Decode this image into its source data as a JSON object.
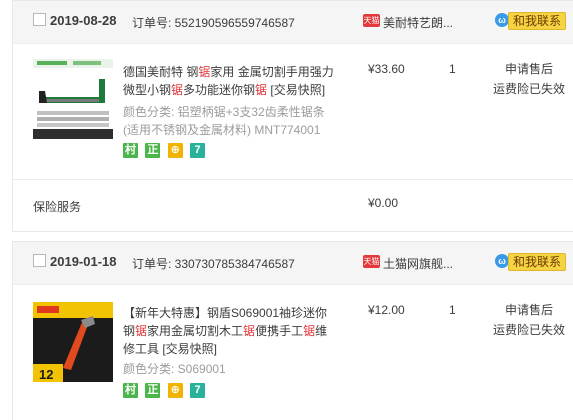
{
  "orders": [
    {
      "date": "2019-08-28",
      "order_label": "订单号: 552190596559746587",
      "shop_icon_text": "天猫",
      "shop_name": "美耐特艺朗...",
      "contact_label": "和我联系",
      "contact_icon": "wangwang-icon",
      "item": {
        "title_parts": [
          "德国美耐特 钢",
          "锯",
          "家用 金属切割手用强力微型小钢",
          "锯",
          "多功能迷你钢",
          "锯",
          " [交易快照]"
        ],
        "sku": "颜色分类: 铝塑柄锯+3支32齿柔性锯条(适用不锈钢及金属材料) MNT774001",
        "tags": [
          "村",
          "正",
          "⊕",
          "7"
        ],
        "price": "¥33.60",
        "qty": "1",
        "status": [
          "申请售后",
          "运费险已失效"
        ]
      },
      "service": {
        "label": "保险服务",
        "price": "¥0.00"
      }
    },
    {
      "date": "2019-01-18",
      "order_label": "订单号: 330730785384746587",
      "shop_icon_text": "天猫",
      "shop_name": "土猫网旗舰...",
      "contact_label": "和我联系",
      "contact_icon": "wangwang-icon",
      "item": {
        "title_parts": [
          "【新年大特惠】钢盾S069001袖珍迷你钢",
          "锯",
          "家用金属切割木工",
          "锯",
          "便携手工",
          "锯",
          "维修工具 [交易快照]"
        ],
        "sku": "颜色分类: S069001",
        "tags": [
          "村",
          "正",
          "⊕",
          "7"
        ],
        "price": "¥12.00",
        "qty": "1",
        "status": [
          "申请售后",
          "运费险已失效"
        ],
        "thumb_text": "12"
      }
    }
  ],
  "colors": {
    "highlight": "#e4393c",
    "header_bg": "#f5f5f5",
    "contact_bg": "#f5d343"
  }
}
